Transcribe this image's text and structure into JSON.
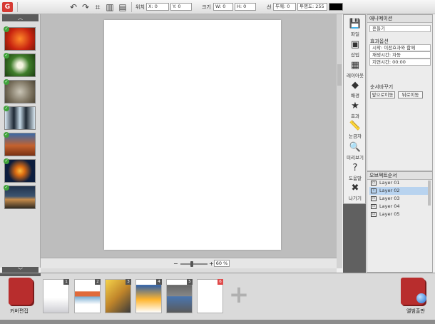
{
  "toolbar": {
    "logo": "G",
    "position_label": "위치",
    "x_value": "X: 0",
    "y_value": "Y: 0",
    "size_label": "크기",
    "w_value": "W: 0",
    "h_value": "H: 0",
    "line_label": "선",
    "thickness_value": "두께: 0",
    "opacity_value": "투명도: 255",
    "line_color": "#000000"
  },
  "thumbnails": [
    "flower",
    "leaf",
    "koala",
    "penguins",
    "desert",
    "jellyfish",
    "lighthouse"
  ],
  "canvas": {
    "zoom_value": "60 %",
    "zoom_minus": "−",
    "zoom_plus": "+"
  },
  "tools": [
    {
      "icon": "💾",
      "label": "파일"
    },
    {
      "icon": "▣",
      "label": "삽입"
    },
    {
      "icon": "▦",
      "label": "레이아웃"
    },
    {
      "icon": "◆",
      "label": "배경"
    },
    {
      "icon": "★",
      "label": "효과"
    },
    {
      "icon": "📏",
      "label": "눈금자"
    },
    {
      "icon": "🔍",
      "label": "미리보기"
    },
    {
      "icon": "?",
      "label": "도움말"
    },
    {
      "icon": "✖",
      "label": "나가기"
    }
  ],
  "animation": {
    "title": "애니메이션",
    "effect_name": "흔들기",
    "effect_option_label": "효과옵션",
    "start": "시작:    이전효과와 함께",
    "repeat": "재생시간:    자동",
    "delay": "지연시간:    00:00",
    "order_label": "순서바꾸기",
    "front_button": "앞으로이동",
    "back_button": "뒤로이동"
  },
  "layers": {
    "title": "오브젝트순서",
    "items": [
      {
        "name": "Layer 01",
        "icon": "▭"
      },
      {
        "name": "Layer 02",
        "icon": "T"
      },
      {
        "name": "Layer 03",
        "icon": "▭"
      },
      {
        "name": "Layer 04",
        "icon": "▭"
      },
      {
        "name": "Layer 05",
        "icon": "▭"
      }
    ]
  },
  "bottom": {
    "cover_edit": "커버편집",
    "album_gallery": "앨범출판",
    "page_numbers": [
      "1",
      "2",
      "3",
      "4",
      "5",
      "6"
    ],
    "add": "+"
  }
}
